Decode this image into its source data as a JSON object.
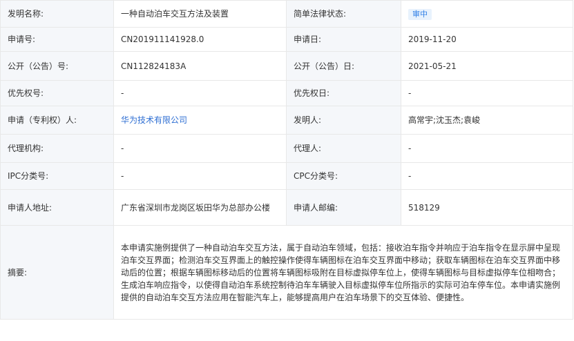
{
  "rows": [
    {
      "l1": "发明名称:",
      "v1": "一种自动泊车交互方法及装置",
      "l2": "简单法律状态:",
      "v2": "审中"
    },
    {
      "l1": "申请号:",
      "v1": "CN201911141928.0",
      "l2": "申请日:",
      "v2": "2019-11-20"
    },
    {
      "l1": "公开（公告）号:",
      "v1": "CN112824183A",
      "l2": "公开（公告）日:",
      "v2": "2021-05-21"
    },
    {
      "l1": "优先权号:",
      "v1": "-",
      "l2": "优先权日:",
      "v2": "-"
    },
    {
      "l1": "申请（专利权）人:",
      "v1": "华为技术有限公司",
      "l2": "发明人:",
      "v2": "高常宇;沈玉杰;袁峻"
    },
    {
      "l1": "代理机构:",
      "v1": "-",
      "l2": "代理人:",
      "v2": "-"
    },
    {
      "l1": "IPC分类号:",
      "v1": "-",
      "l2": "CPC分类号:",
      "v2": "-"
    },
    {
      "l1": "申请人地址:",
      "v1": "广东省深圳市龙岗区坂田华为总部办公楼",
      "l2": "申请人邮编:",
      "v2": "518129"
    }
  ],
  "abstract": {
    "label": "摘要:",
    "text": "本申请实施例提供了一种自动泊车交互方法，属于自动泊车领域，包括：接收泊车指令并响应于泊车指令在显示屏中呈现泊车交互界面；检测泊车交互界面上的触控操作使得车辆图标在泊车交互界面中移动；获取车辆图标在泊车交互界面中移动后的位置；根据车辆图标移动后的位置将车辆图标吸附在目标虚拟停车位上，使得车辆图标与目标虚拟停车位相吻合；生成泊车响应指令，以使得自动泊车系统控制待泊车车辆驶入目标虚拟停车位所指示的实际可泊车停车位。本申请实施例提供的自动泊车交互方法应用在智能汽车上，能够提高用户在泊车场景下的交互体验、便捷性。"
  },
  "colors": {
    "label_bg": "#f5f7fa",
    "border": "#e8e8e8",
    "link": "#2f6fd3",
    "badge_bg": "#e8f2fd",
    "badge_text": "#2f7fe6"
  }
}
